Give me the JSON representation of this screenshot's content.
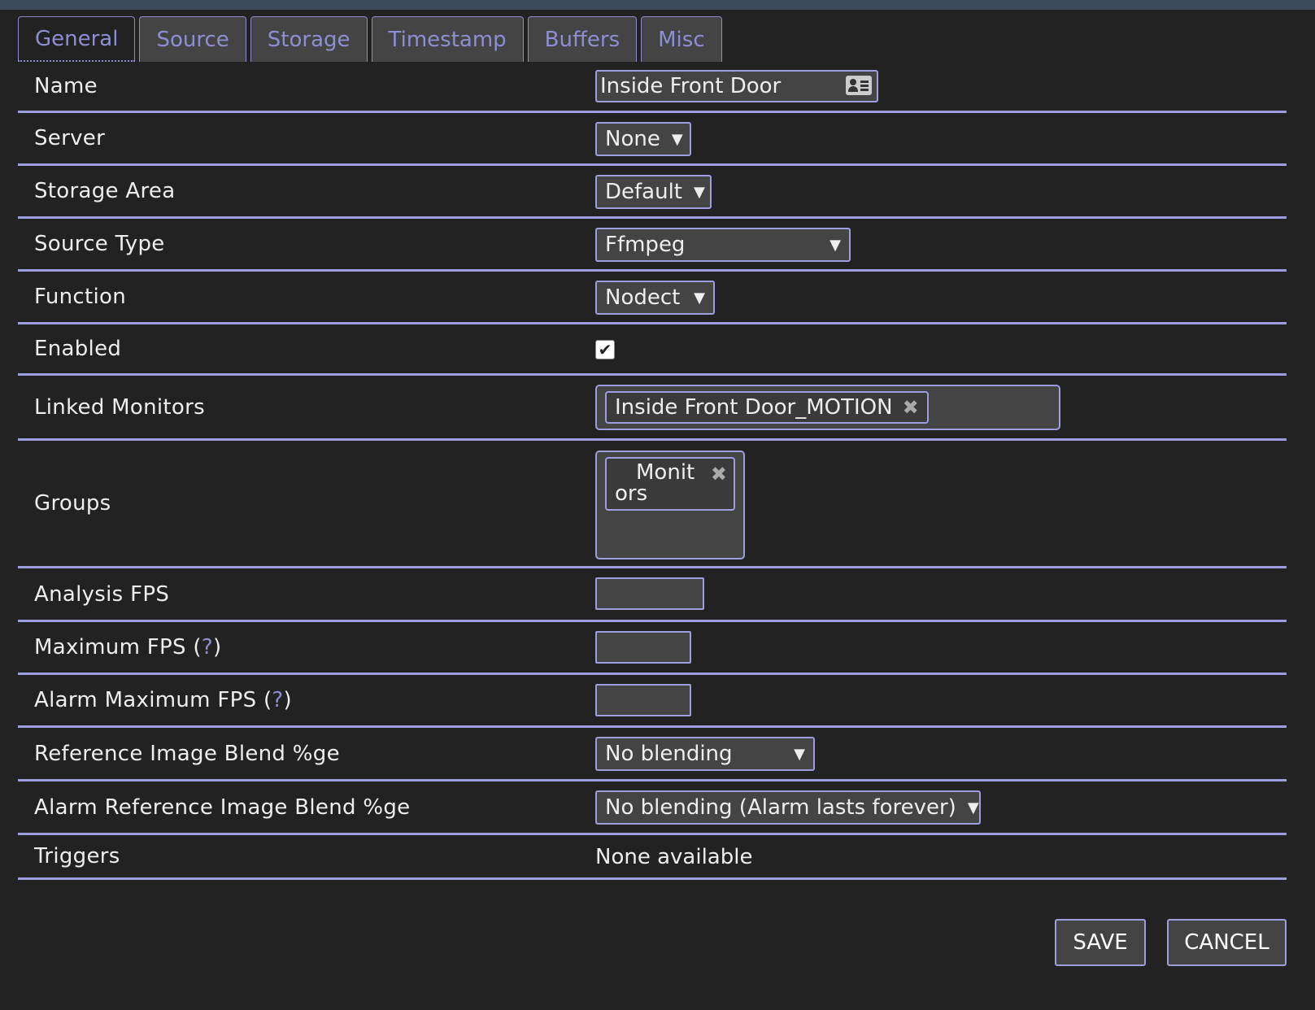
{
  "tabs": [
    {
      "label": "General",
      "active": true
    },
    {
      "label": "Source"
    },
    {
      "label": "Storage"
    },
    {
      "label": "Timestamp"
    },
    {
      "label": "Buffers"
    },
    {
      "label": "Misc"
    }
  ],
  "fields": {
    "name": {
      "label": "Name",
      "value": "Inside Front Door"
    },
    "server": {
      "label": "Server",
      "value": "None"
    },
    "storage_area": {
      "label": "Storage Area",
      "value": "Default"
    },
    "source_type": {
      "label": "Source Type",
      "value": "Ffmpeg"
    },
    "function": {
      "label": "Function",
      "value": "Nodect"
    },
    "enabled": {
      "label": "Enabled",
      "checked": true,
      "check_glyph": "✔"
    },
    "linked_monitors": {
      "label": "Linked Monitors",
      "chips": [
        "Inside Front Door_MOTION"
      ]
    },
    "groups": {
      "label": "Groups",
      "chip_line1": "Monit",
      "chip_line2": "ors"
    },
    "analysis_fps": {
      "label": "Analysis FPS",
      "value": ""
    },
    "maximum_fps": {
      "label": "Maximum FPS (",
      "help": "?",
      "close": ")",
      "value": ""
    },
    "alarm_maximum_fps": {
      "label": "Alarm Maximum FPS (",
      "help": "?",
      "close": ")",
      "value": ""
    },
    "ref_blend": {
      "label": "Reference Image Blend %ge",
      "value": "No blending"
    },
    "alarm_ref_blend": {
      "label": "Alarm Reference Image Blend %ge",
      "value": "No blending (Alarm lasts forever)"
    },
    "triggers": {
      "label": "Triggers",
      "value": "None available"
    }
  },
  "glyphs": {
    "dropdown_arrow": "▼",
    "remove": "✖"
  },
  "buttons": {
    "save": "SAVE",
    "cancel": "CANCEL"
  },
  "colors": {
    "accent": "#9d9de0",
    "tab_text": "#8e8ed4",
    "background": "#222222",
    "field_bg": "#444444"
  }
}
